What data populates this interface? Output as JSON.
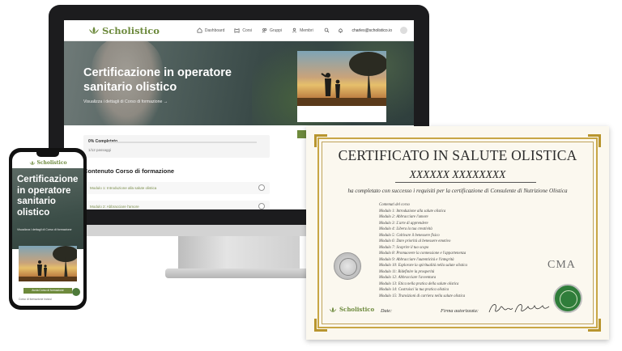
{
  "brand": {
    "name": "Scholistico",
    "color": "#6d8a3d"
  },
  "desktop": {
    "nav": {
      "items": [
        {
          "label": "Dashboard",
          "icon": "home-icon"
        },
        {
          "label": "Corsi",
          "icon": "book-icon"
        },
        {
          "label": "Gruppi",
          "icon": "users-icon"
        },
        {
          "label": "Membri",
          "icon": "members-icon"
        }
      ],
      "user": "charles@scholistico.io"
    },
    "hero": {
      "title": "Certificazione in operatore sanitario olistico",
      "subtitle": "Visualizza i dettagli di Corso di formazione"
    },
    "progress": {
      "title": "0% Completato",
      "count": "1/12 passaggi"
    },
    "content_heading": "Contenuto Corso di formazione",
    "modules": [
      "Modulo 1: Introduzione alla salute olistica",
      "Modulo 2: Abbracciare l'amore"
    ]
  },
  "phone": {
    "hero_title": "Certificazione in operatore sanitario olistico",
    "hero_subtitle": "Visualizza i dettagli di Corso di formazione",
    "cta_label": "Avvia Corso di formazione",
    "footer_text": "Corso di formazione inclusi"
  },
  "certificate": {
    "title": "CERTIFICATO IN SALUTE OLISTICA",
    "name": "XXXXXX XXXXXXXX",
    "statement": "ha completato con successo i requisiti per la certificazione di Consulente di Nutrizione Olistica",
    "contents_heading": "Contenuti del corso",
    "modules": [
      "Modulo 1: Introduzione alla salute olistica",
      "Modulo 2: Abbracciare l'amore",
      "Modulo 3: L'arte di apprendere",
      "Modulo 4: Libera la tua creatività",
      "Modulo 5: Coltivare il benessere fisico",
      "Modulo 6: Dare priorità al benessere emotivo",
      "Modulo 7: Scoprire il tuo scopo",
      "Modulo 8: Promuovere la connessione e l'appartenenza",
      "Modulo 9: Abbracciare l'autenticità e l'integrità",
      "Modulo 10: Esplorare la spiritualità nella salute olistica",
      "Modulo 11: Ridefinire la prosperità",
      "Modulo 12: Abbracciare l'avventura",
      "Modulo 13: Etica nella pratica della salute olistica",
      "Modulo 14: Costruisci la tua pratica olistica",
      "Modulo 15: Transizioni di carriera nella salute olistica"
    ],
    "cma_logo": "CMA",
    "date_label": "Date:",
    "signature_label": "Firma autorizzata:",
    "signature_text": "Charles Capicotto",
    "frame_color": "#c8a645"
  }
}
